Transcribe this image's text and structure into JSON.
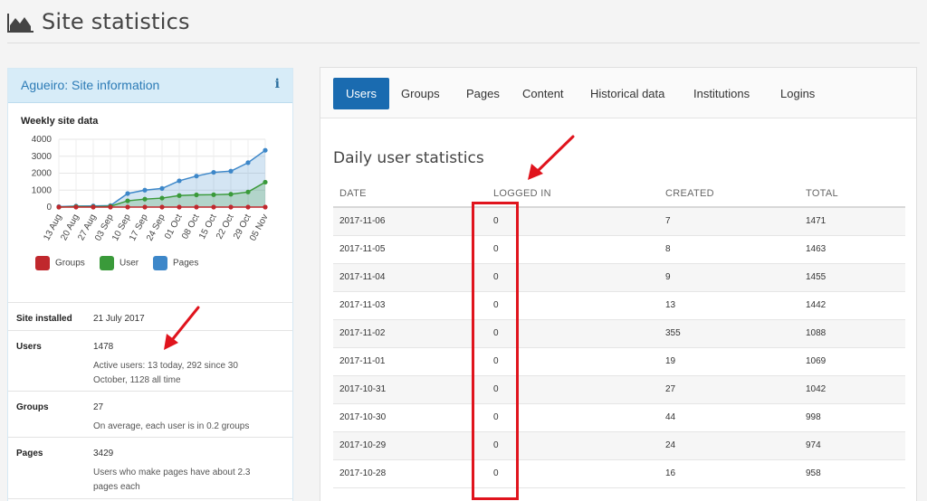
{
  "page": {
    "title": "Site statistics",
    "title_icon": "area-chart-icon"
  },
  "info_panel": {
    "title": "Agueiro: Site information",
    "info_icon_glyph": "i",
    "rows": [
      {
        "key": "Site installed",
        "value": "21 July 2017",
        "sub": ""
      },
      {
        "key": "Users",
        "value": "1478",
        "sub": "Active users: 13 today, 292 since 30 October, 1128 all time"
      },
      {
        "key": "Groups",
        "value": "27",
        "sub": "On average, each user is in 0.2 groups"
      },
      {
        "key": "Pages",
        "value": "3429",
        "sub": "Users who make pages have about 2.3 pages each"
      }
    ]
  },
  "chart_data": {
    "type": "line",
    "title": "Weekly site data",
    "categories": [
      "13 Aug",
      "20 Aug",
      "27 Aug",
      "03 Sep",
      "10 Sep",
      "17 Sep",
      "24 Sep",
      "01 Oct",
      "08 Oct",
      "15 Oct",
      "22 Oct",
      "29 Oct",
      "05 Nov"
    ],
    "series": [
      {
        "name": "Groups",
        "color": "#c0282d",
        "values": [
          0,
          0,
          0,
          0,
          0,
          0,
          0,
          0,
          0,
          0,
          0,
          0,
          0
        ]
      },
      {
        "name": "User",
        "color": "#3a9a3a",
        "values": [
          0,
          30,
          20,
          50,
          370,
          470,
          530,
          680,
          720,
          730,
          760,
          890,
          1470
        ]
      },
      {
        "name": "Pages",
        "color": "#3d87c9",
        "values": [
          30,
          60,
          70,
          90,
          800,
          1000,
          1100,
          1550,
          1830,
          2050,
          2120,
          2620,
          3350
        ]
      }
    ],
    "yticks": [
      0,
      1000,
      2000,
      3000,
      4000
    ],
    "ylim": [
      0,
      4000
    ],
    "grid": true,
    "legend_position": "bottom"
  },
  "stats": {
    "tabs": [
      "Users",
      "Groups",
      "Pages",
      "Content",
      "Historical data",
      "Institutions",
      "Logins"
    ],
    "active_tab": "Users",
    "section_title": "Daily user statistics",
    "columns": [
      "DATE",
      "LOGGED IN",
      "CREATED",
      "TOTAL"
    ],
    "rows": [
      [
        "2017-11-06",
        "0",
        "7",
        "1471"
      ],
      [
        "2017-11-05",
        "0",
        "8",
        "1463"
      ],
      [
        "2017-11-04",
        "0",
        "9",
        "1455"
      ],
      [
        "2017-11-03",
        "0",
        "13",
        "1442"
      ],
      [
        "2017-11-02",
        "0",
        "355",
        "1088"
      ],
      [
        "2017-11-01",
        "0",
        "19",
        "1069"
      ],
      [
        "2017-10-31",
        "0",
        "27",
        "1042"
      ],
      [
        "2017-10-30",
        "0",
        "44",
        "998"
      ],
      [
        "2017-10-29",
        "0",
        "24",
        "974"
      ],
      [
        "2017-10-28",
        "0",
        "16",
        "958"
      ]
    ]
  },
  "annotation_color": "#e0141d"
}
